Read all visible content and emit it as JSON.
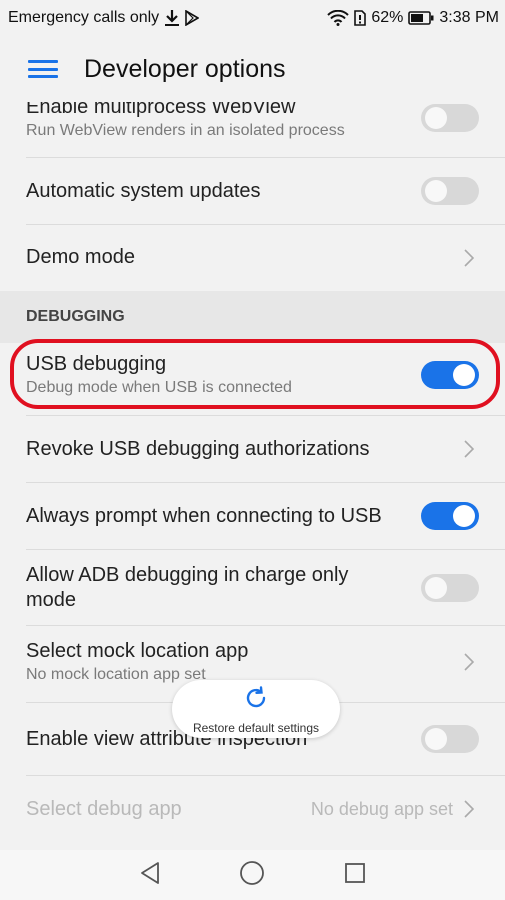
{
  "status_bar": {
    "left_text": "Emergency calls only",
    "battery": "62%",
    "time": "3:38 PM",
    "icons": [
      "download-icon",
      "play-store-icon",
      "wifi-icon",
      "sim-alert-icon",
      "battery-icon"
    ]
  },
  "app_bar": {
    "title": "Developer options",
    "menu_icon": "hamburger-menu-icon"
  },
  "colors": {
    "accent": "#1a73e8",
    "highlight": "#e01020",
    "background": "#f2f2f2"
  },
  "settings": {
    "multiprocess": {
      "title": "Enable multiprocess WebView",
      "subtitle": "Run WebView renders in an isolated process",
      "enabled": false
    },
    "auto_updates": {
      "title": "Automatic system updates",
      "enabled": false
    },
    "demo_mode": {
      "title": "Demo mode"
    },
    "debugging_header": "DEBUGGING",
    "usb_debugging": {
      "title": "USB debugging",
      "subtitle": "Debug mode when USB is connected",
      "enabled": true
    },
    "revoke_usb": {
      "title": "Revoke USB debugging authorizations"
    },
    "always_prompt": {
      "title": "Always prompt when connecting to USB",
      "enabled": true
    },
    "adb_charge": {
      "title": "Allow ADB debugging in charge only mode",
      "enabled": false
    },
    "mock_location": {
      "title": "Select mock location app",
      "subtitle": "No mock location app set"
    },
    "view_attr": {
      "title": "Enable view attribute inspection",
      "enabled": false
    },
    "debug_app": {
      "title": "Select debug app",
      "value": "No debug app set"
    }
  },
  "toast": {
    "label": "Restore default settings"
  },
  "nav_bar": {
    "icons": [
      "back-icon",
      "home-icon",
      "recents-icon"
    ]
  }
}
